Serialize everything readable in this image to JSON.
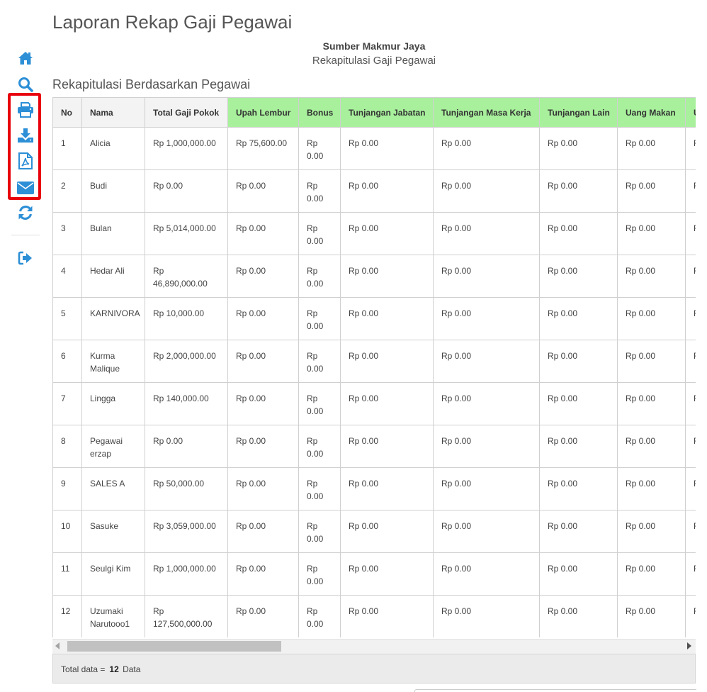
{
  "page": {
    "title": "Laporan Rekap Gaji Pegawai"
  },
  "report": {
    "company": "Sumber Makmur Jaya",
    "subtitle": "Rekapitulasi Gaji Pegawai",
    "section": "Rekapitulasi Berdasarkan Pegawai"
  },
  "sidebar": {
    "icons": [
      "home-icon",
      "search-icon",
      "print-icon",
      "download-icon",
      "pdf-icon",
      "email-icon",
      "refresh-icon",
      "logout-icon"
    ],
    "icon_color": "#2d8fd6",
    "highlight_color": "#e8000b"
  },
  "table": {
    "columns": [
      {
        "label": "No",
        "style": "gray"
      },
      {
        "label": "Nama",
        "style": "gray"
      },
      {
        "label": "Total Gaji Pokok",
        "style": "gray"
      },
      {
        "label": "Upah Lembur",
        "style": "green"
      },
      {
        "label": "Bonus",
        "style": "green"
      },
      {
        "label": "Tunjangan Jabatan",
        "style": "green"
      },
      {
        "label": "Tunjangan Masa Kerja",
        "style": "green"
      },
      {
        "label": "Tunjangan Lain",
        "style": "green"
      },
      {
        "label": "Uang Makan",
        "style": "green"
      },
      {
        "label": "U",
        "style": "green"
      }
    ],
    "header_green": "#a8f09c",
    "rows": [
      [
        "1",
        "Alicia",
        "Rp 1,000,000.00",
        "Rp 75,600.00",
        "Rp 0.00",
        "Rp 0.00",
        "Rp 0.00",
        "Rp 0.00",
        "Rp 0.00",
        "F"
      ],
      [
        "2",
        "Budi",
        "Rp 0.00",
        "Rp 0.00",
        "Rp 0.00",
        "Rp 0.00",
        "Rp 0.00",
        "Rp 0.00",
        "Rp 0.00",
        "F"
      ],
      [
        "3",
        "Bulan",
        "Rp 5,014,000.00",
        "Rp 0.00",
        "Rp 0.00",
        "Rp 0.00",
        "Rp 0.00",
        "Rp 0.00",
        "Rp 0.00",
        "F"
      ],
      [
        "4",
        "Hedar Ali",
        "Rp 46,890,000.00",
        "Rp 0.00",
        "Rp 0.00",
        "Rp 0.00",
        "Rp 0.00",
        "Rp 0.00",
        "Rp 0.00",
        "F"
      ],
      [
        "5",
        "KARNIVORA",
        "Rp 10,000.00",
        "Rp 0.00",
        "Rp 0.00",
        "Rp 0.00",
        "Rp 0.00",
        "Rp 0.00",
        "Rp 0.00",
        "F"
      ],
      [
        "6",
        "Kurma Malique",
        "Rp 2,000,000.00",
        "Rp 0.00",
        "Rp 0.00",
        "Rp 0.00",
        "Rp 0.00",
        "Rp 0.00",
        "Rp 0.00",
        "F"
      ],
      [
        "7",
        "Lingga",
        "Rp 140,000.00",
        "Rp 0.00",
        "Rp 0.00",
        "Rp 0.00",
        "Rp 0.00",
        "Rp 0.00",
        "Rp 0.00",
        "F"
      ],
      [
        "8",
        "Pegawai erzap",
        "Rp 0.00",
        "Rp 0.00",
        "Rp 0.00",
        "Rp 0.00",
        "Rp 0.00",
        "Rp 0.00",
        "Rp 0.00",
        "F"
      ],
      [
        "9",
        "SALES A",
        "Rp 50,000.00",
        "Rp 0.00",
        "Rp 0.00",
        "Rp 0.00",
        "Rp 0.00",
        "Rp 0.00",
        "Rp 0.00",
        "F"
      ],
      [
        "10",
        "Sasuke",
        "Rp 3,059,000.00",
        "Rp 0.00",
        "Rp 0.00",
        "Rp 0.00",
        "Rp 0.00",
        "Rp 0.00",
        "Rp 0.00",
        "F"
      ],
      [
        "11",
        "Seulgi Kim",
        "Rp 1,000,000.00",
        "Rp 0.00",
        "Rp 0.00",
        "Rp 0.00",
        "Rp 0.00",
        "Rp 0.00",
        "Rp 0.00",
        "F"
      ],
      [
        "12",
        "Uzumaki Narutooo1",
        "Rp 127,500,000.00",
        "Rp 0.00",
        "Rp 0.00",
        "Rp 0.00",
        "Rp 0.00",
        "Rp 0.00",
        "Rp 0.00",
        "F"
      ]
    ]
  },
  "footer": {
    "label": "Total data =",
    "count": "12",
    "suffix": "Data"
  }
}
